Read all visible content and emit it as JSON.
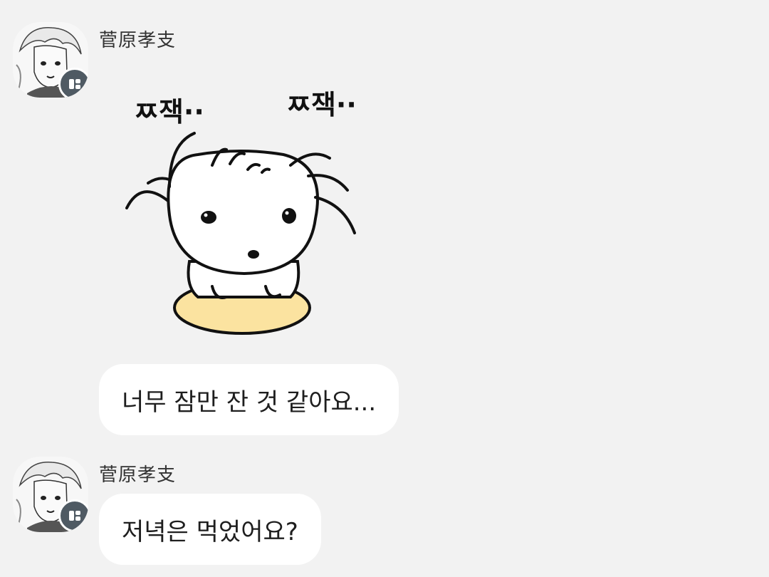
{
  "messages": [
    {
      "sender": "菅原孝支",
      "sticker_text_left": "ㅉ잭··",
      "sticker_text_right": "ㅉ잭··",
      "text": "너무 잠만 잔 것 같아요..."
    },
    {
      "sender": "菅原孝支",
      "text": "저녁은 먹었어요?"
    }
  ],
  "icons": {
    "avatar_badge": "chat-app-icon",
    "avatar": "anime-character-avatar"
  },
  "colors": {
    "background": "#f2f2f2",
    "bubble": "#ffffff",
    "badge": "#4f5a63",
    "sticker_cushion": "#fbe3a0"
  }
}
